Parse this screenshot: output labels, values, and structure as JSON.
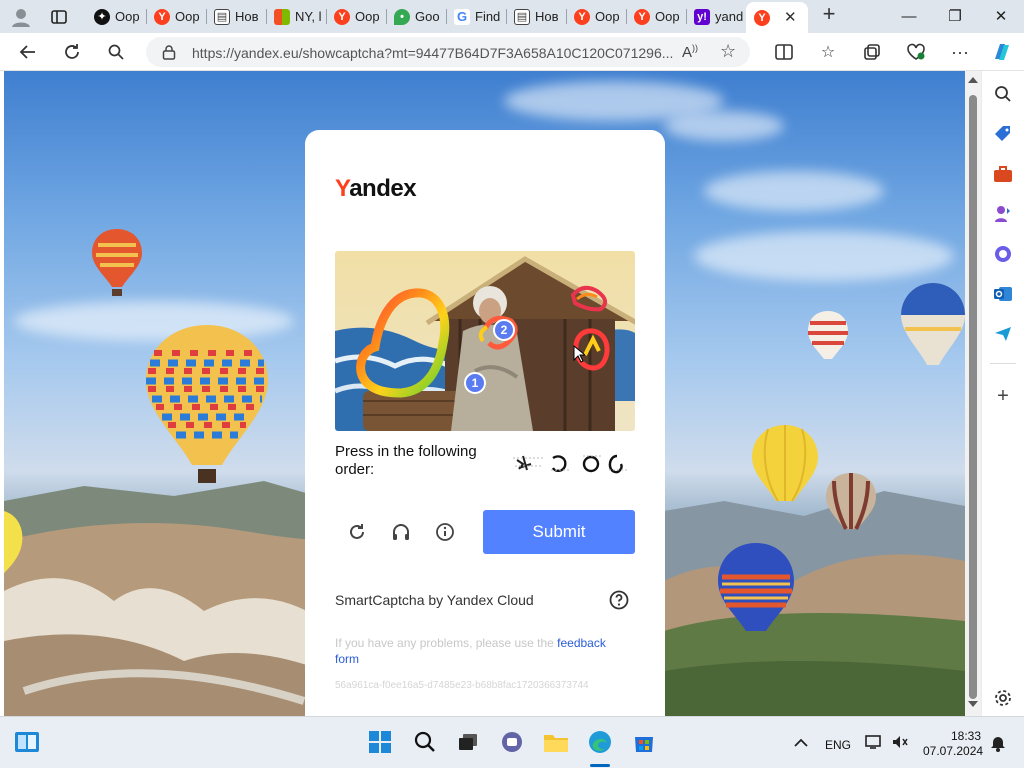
{
  "browser": {
    "tabs": [
      {
        "label": "Oop",
        "icon": "chatgpt-icon",
        "color": "#111111"
      },
      {
        "label": "Oop",
        "icon": "yandex-icon",
        "color": "#fc3f1d"
      },
      {
        "label": "Нов",
        "icon": "news-icon",
        "color": "#444444"
      },
      {
        "label": "NY, l",
        "icon": "microsoft-icon",
        "color": "#f25022"
      },
      {
        "label": "Oop",
        "icon": "yandex-icon",
        "color": "#fc3f1d"
      },
      {
        "label": "Goo",
        "icon": "maps-icon",
        "color": "#34a853"
      },
      {
        "label": "Find",
        "icon": "google-icon",
        "color": "#4285f4"
      },
      {
        "label": "Нов",
        "icon": "news-icon",
        "color": "#444444"
      },
      {
        "label": "Oop",
        "icon": "yandex-icon",
        "color": "#fc3f1d"
      },
      {
        "label": "Oop",
        "icon": "yandex-icon",
        "color": "#fc3f1d"
      },
      {
        "label": "yand",
        "icon": "yahoo-icon",
        "color": "#6001d2"
      },
      {
        "label": "",
        "icon": "yandex-icon",
        "color": "#fc3f1d"
      }
    ],
    "url": "https://yandex.eu/showcaptcha?mt=94477B64D7F3A658A10C120C071296..."
  },
  "captcha": {
    "logo_first": "Y",
    "logo_rest": "andex",
    "prompt": "Press in the following order:",
    "markers": [
      "1",
      "2"
    ],
    "submit_label": "Submit",
    "brand": "SmartCaptcha by Yandex Cloud",
    "problem_text": "If you have any problems, please use the ",
    "feedback_link": "feedback form",
    "hash": "56a961ca-f0ee16a5-d7485e23-b68b8fac1720366373744"
  },
  "taskbar": {
    "language": "ENG",
    "time": "18:33",
    "date": "07.07.2024"
  },
  "colors": {
    "accent": "#5282ff",
    "yandex_red": "#fc3f1d"
  }
}
